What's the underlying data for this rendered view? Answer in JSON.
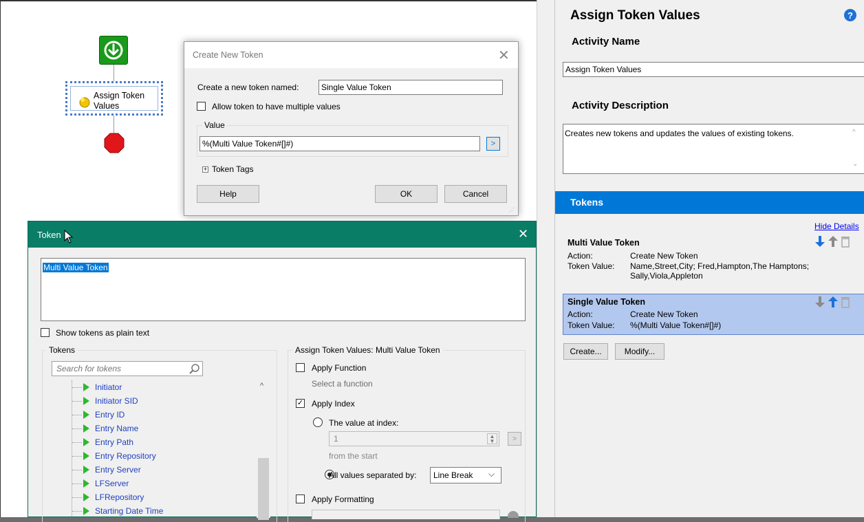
{
  "workflow": {
    "activity_label_line1": "Assign Token",
    "activity_label_line2": "Values"
  },
  "create_dialog": {
    "title": "Create New Token",
    "name_label": "Create a new token named:",
    "name_value": "Single Value Token",
    "allow_multiple_label": "Allow token to have multiple values",
    "value_group_label": "Value",
    "value_text": "%(Multi Value Token#[]#)",
    "token_tags_label": "Token Tags",
    "help": "Help",
    "ok": "OK",
    "cancel": "Cancel"
  },
  "token_dialog": {
    "title": "Token",
    "editor_text": "Multi Value Token",
    "show_plain_label": "Show tokens as plain text",
    "tokens_group_label": "Tokens",
    "search_placeholder": "Search for tokens",
    "tree_items": [
      "Initiator",
      "Initiator SID",
      "Entry ID",
      "Entry Name",
      "Entry Path",
      "Entry Repository",
      "Entry Server",
      "LFServer",
      "LFRepository",
      "Starting Date Time"
    ],
    "assign_group_label": "Assign Token Values: Multi Value Token",
    "apply_function_label": "Apply Function",
    "select_function_label": "Select a function",
    "apply_index_label": "Apply Index",
    "value_at_index_label": "The value at index:",
    "index_value": "1",
    "from_start_label": "from the  start",
    "all_values_label": "All values separated by:",
    "separator_value": "Line Break",
    "apply_formatting_label": "Apply Formatting"
  },
  "panel": {
    "title": "Assign Token Values",
    "activity_name_heading": "Activity Name",
    "activity_name_value": "Assign Token Values",
    "activity_description_heading": "Activity Description",
    "activity_description_value": "Creates new tokens and updates the values of existing tokens.",
    "tokens_heading": "Tokens",
    "hide_details": "Hide Details",
    "tokens": [
      {
        "name": "Multi Value Token",
        "action_label": "Action:",
        "action": "Create New Token",
        "value_label": "Token Value:",
        "value_line1": "Name,Street,City; Fred,Hampton,The Hamptons;",
        "value_line2": "Sally,Viola,Appleton"
      },
      {
        "name": "Single Value Token",
        "action_label": "Action:",
        "action": "Create New Token",
        "value_label": "Token Value:",
        "value_line1": "%(Multi Value Token#[]#)",
        "value_line2": ""
      }
    ],
    "create_button": "Create...",
    "modify_button": "Modify..."
  },
  "colors": {
    "accent_blue": "#0078d7",
    "token_dialog_title": "#0a7d67",
    "selected_token_bg": "#b3c8ee",
    "start_green": "#1a9a1a",
    "stop_red": "#e0161b"
  }
}
